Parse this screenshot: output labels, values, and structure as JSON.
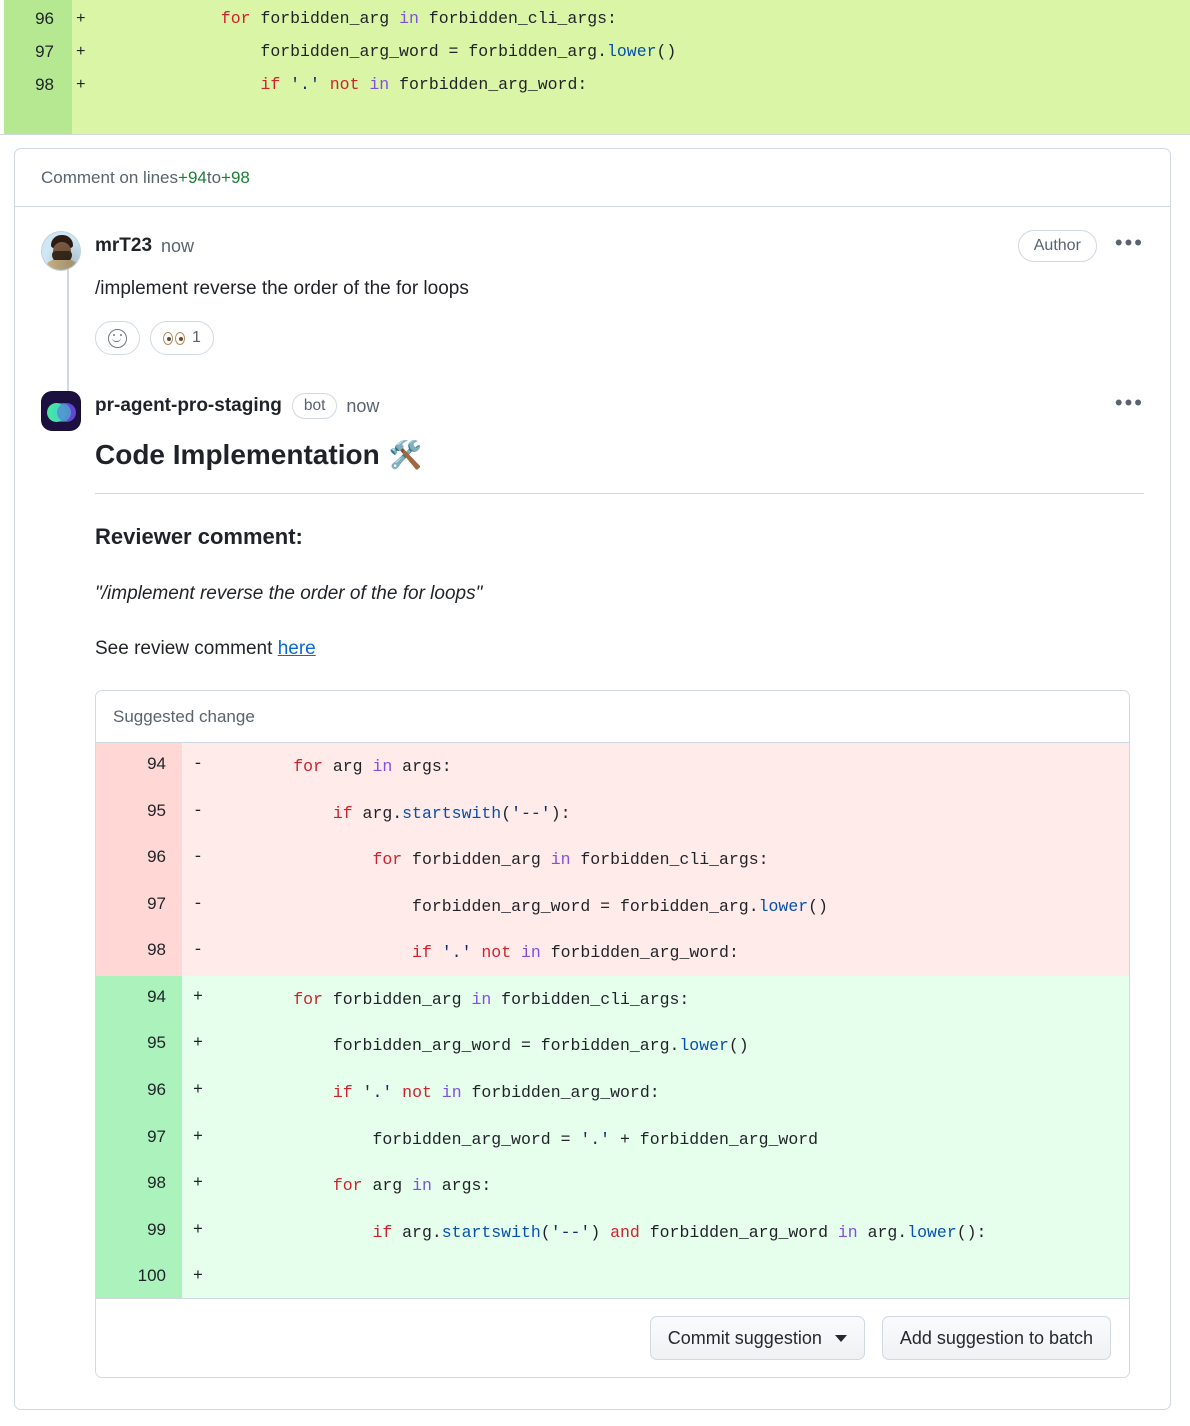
{
  "top_diff": {
    "lines": [
      {
        "no": "96",
        "sign": "+",
        "tokens": [
          {
            "t": "            ",
            "c": "op"
          },
          {
            "t": "for",
            "c": "k"
          },
          {
            "t": " forbidden_arg ",
            "c": "op"
          },
          {
            "t": "in",
            "c": "ky"
          },
          {
            "t": " forbidden_cli_args:",
            "c": "op"
          }
        ]
      },
      {
        "no": "97",
        "sign": "+",
        "tokens": [
          {
            "t": "                forbidden_arg_word = forbidden_arg.",
            "c": "op"
          },
          {
            "t": "lower",
            "c": "fn"
          },
          {
            "t": "()",
            "c": "op"
          }
        ]
      },
      {
        "no": "98",
        "sign": "+",
        "tokens": [
          {
            "t": "                ",
            "c": "op"
          },
          {
            "t": "if",
            "c": "k"
          },
          {
            "t": " ",
            "c": "op"
          },
          {
            "t": "'.'",
            "c": "st"
          },
          {
            "t": " ",
            "c": "op"
          },
          {
            "t": "not",
            "c": "k"
          },
          {
            "t": " ",
            "c": "op"
          },
          {
            "t": "in",
            "c": "ky"
          },
          {
            "t": " forbidden_arg_word:",
            "c": "op"
          }
        ]
      }
    ]
  },
  "card": {
    "header_prefix": "Comment on lines ",
    "header_from": "+94",
    "header_mid": " to ",
    "header_to": "+98"
  },
  "user_comment": {
    "username": "mrT23",
    "timestamp": "now",
    "author_badge": "Author",
    "kebab": "•••",
    "body": "/implement reverse the order of the for loops",
    "reactions": [
      {
        "icon": "add-reaction-icon",
        "count": ""
      },
      {
        "icon": "eyes-emoji",
        "count": "1"
      }
    ]
  },
  "bot_comment": {
    "username": "pr-agent-pro-staging",
    "bot_label": "bot",
    "timestamp": "now",
    "kebab": "•••",
    "title": "Code Implementation",
    "title_emoji": "🛠️",
    "section_heading": "Reviewer comment:",
    "quoted_comment": "\"/implement reverse the order of the for loops\"",
    "see_text": "See review comment ",
    "see_link": "here"
  },
  "suggestion": {
    "header": "Suggested change",
    "rows": [
      {
        "no": "94",
        "sign": "-",
        "type": "del",
        "tokens": [
          {
            "t": "        ",
            "c": "op"
          },
          {
            "t": "for",
            "c": "k"
          },
          {
            "t": " arg ",
            "c": "op"
          },
          {
            "t": "in",
            "c": "ky"
          },
          {
            "t": " args:",
            "c": "op"
          }
        ]
      },
      {
        "no": "95",
        "sign": "-",
        "type": "del",
        "tokens": [
          {
            "t": "            ",
            "c": "op"
          },
          {
            "t": "if",
            "c": "k"
          },
          {
            "t": " arg.",
            "c": "op"
          },
          {
            "t": "startswith",
            "c": "fn"
          },
          {
            "t": "(",
            "c": "op"
          },
          {
            "t": "'--'",
            "c": "st"
          },
          {
            "t": "):",
            "c": "op"
          }
        ]
      },
      {
        "no": "96",
        "sign": "-",
        "type": "del",
        "tokens": [
          {
            "t": "                ",
            "c": "op"
          },
          {
            "t": "for",
            "c": "k"
          },
          {
            "t": " forbidden_arg ",
            "c": "op"
          },
          {
            "t": "in",
            "c": "ky"
          },
          {
            "t": " forbidden_cli_args:",
            "c": "op"
          }
        ]
      },
      {
        "no": "97",
        "sign": "-",
        "type": "del",
        "tokens": [
          {
            "t": "                    forbidden_arg_word = forbidden_arg.",
            "c": "op"
          },
          {
            "t": "lower",
            "c": "fn"
          },
          {
            "t": "()",
            "c": "op"
          }
        ]
      },
      {
        "no": "98",
        "sign": "-",
        "type": "del",
        "tokens": [
          {
            "t": "                    ",
            "c": "op"
          },
          {
            "t": "if",
            "c": "k"
          },
          {
            "t": " ",
            "c": "op"
          },
          {
            "t": "'.'",
            "c": "st"
          },
          {
            "t": " ",
            "c": "op"
          },
          {
            "t": "not",
            "c": "k"
          },
          {
            "t": " ",
            "c": "op"
          },
          {
            "t": "in",
            "c": "ky"
          },
          {
            "t": " forbidden_arg_word:",
            "c": "op"
          }
        ]
      },
      {
        "no": "94",
        "sign": "+",
        "type": "add",
        "tokens": [
          {
            "t": "        ",
            "c": "op"
          },
          {
            "t": "for",
            "c": "k"
          },
          {
            "t": " forbidden_arg ",
            "c": "op"
          },
          {
            "t": "in",
            "c": "ky"
          },
          {
            "t": " forbidden_cli_args:",
            "c": "op"
          }
        ]
      },
      {
        "no": "95",
        "sign": "+",
        "type": "add",
        "tokens": [
          {
            "t": "            forbidden_arg_word = forbidden_arg.",
            "c": "op"
          },
          {
            "t": "lower",
            "c": "fn"
          },
          {
            "t": "()",
            "c": "op"
          }
        ]
      },
      {
        "no": "96",
        "sign": "+",
        "type": "add",
        "tokens": [
          {
            "t": "            ",
            "c": "op"
          },
          {
            "t": "if",
            "c": "k"
          },
          {
            "t": " ",
            "c": "op"
          },
          {
            "t": "'.'",
            "c": "st"
          },
          {
            "t": " ",
            "c": "op"
          },
          {
            "t": "not",
            "c": "k"
          },
          {
            "t": " ",
            "c": "op"
          },
          {
            "t": "in",
            "c": "ky"
          },
          {
            "t": " forbidden_arg_word:",
            "c": "op"
          }
        ]
      },
      {
        "no": "97",
        "sign": "+",
        "type": "add",
        "tokens": [
          {
            "t": "                forbidden_arg_word = ",
            "c": "op"
          },
          {
            "t": "'.'",
            "c": "st"
          },
          {
            "t": " + forbidden_arg_word",
            "c": "op"
          }
        ]
      },
      {
        "no": "98",
        "sign": "+",
        "type": "add",
        "tokens": [
          {
            "t": "            ",
            "c": "op"
          },
          {
            "t": "for",
            "c": "k"
          },
          {
            "t": " arg ",
            "c": "op"
          },
          {
            "t": "in",
            "c": "ky"
          },
          {
            "t": " args:",
            "c": "op"
          }
        ]
      },
      {
        "no": "99",
        "sign": "+",
        "type": "add",
        "tokens": [
          {
            "t": "                ",
            "c": "op"
          },
          {
            "t": "if",
            "c": "k"
          },
          {
            "t": " arg.",
            "c": "op"
          },
          {
            "t": "startswith",
            "c": "fn"
          },
          {
            "t": "(",
            "c": "op"
          },
          {
            "t": "'--'",
            "c": "st"
          },
          {
            "t": ") ",
            "c": "op"
          },
          {
            "t": "and",
            "c": "k"
          },
          {
            "t": " forbidden_arg_word ",
            "c": "op"
          },
          {
            "t": "in",
            "c": "ky"
          },
          {
            "t": " arg.",
            "c": "op"
          },
          {
            "t": "lower",
            "c": "fn"
          },
          {
            "t": "():",
            "c": "op"
          }
        ]
      },
      {
        "no": "100",
        "sign": "+",
        "type": "add",
        "tokens": []
      }
    ],
    "commit_button": "Commit suggestion",
    "batch_button": "Add suggestion to batch"
  },
  "colors": {
    "diff_add_bg": "#e6ffec",
    "diff_add_gutter": "#abf2bc",
    "diff_del_bg": "#ffebe9",
    "diff_del_gutter": "#ffd7d5",
    "highlight_add_bg": "#d9f5a5",
    "highlight_add_gutter": "#b5e890",
    "link": "#0969da",
    "border": "#d1d9e0",
    "muted_text": "#59636e",
    "text": "#1f2328",
    "keyword": "#cf222e",
    "operator_keyword": "#8250df",
    "function": "#0550ae",
    "string": "#0a3069"
  }
}
